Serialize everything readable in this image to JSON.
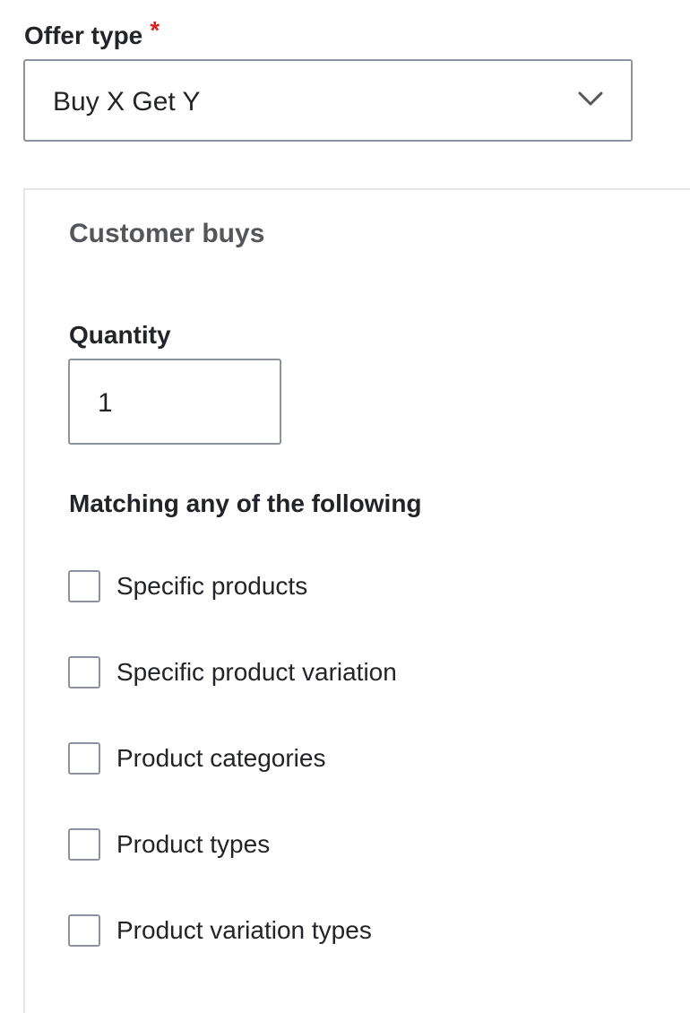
{
  "offer_type": {
    "label": "Offer type",
    "required_marker": "*",
    "selected_value": "Buy X Get Y",
    "dropdown_icon": "chevron-down-icon"
  },
  "customer_buys": {
    "legend": "Customer buys",
    "quantity": {
      "label": "Quantity",
      "value": "1"
    },
    "matching": {
      "label": "Matching any of the following",
      "options": [
        {
          "label": "Specific products",
          "checked": false
        },
        {
          "label": "Specific product variation",
          "checked": false
        },
        {
          "label": "Product categories",
          "checked": false
        },
        {
          "label": "Product types",
          "checked": false
        },
        {
          "label": "Product variation types",
          "checked": false
        }
      ]
    }
  },
  "colors": {
    "text": "#232429",
    "legend_text": "#55565b",
    "required": "#d72222",
    "border": "#8e929c",
    "fieldset_border": "#e6e6e8"
  }
}
